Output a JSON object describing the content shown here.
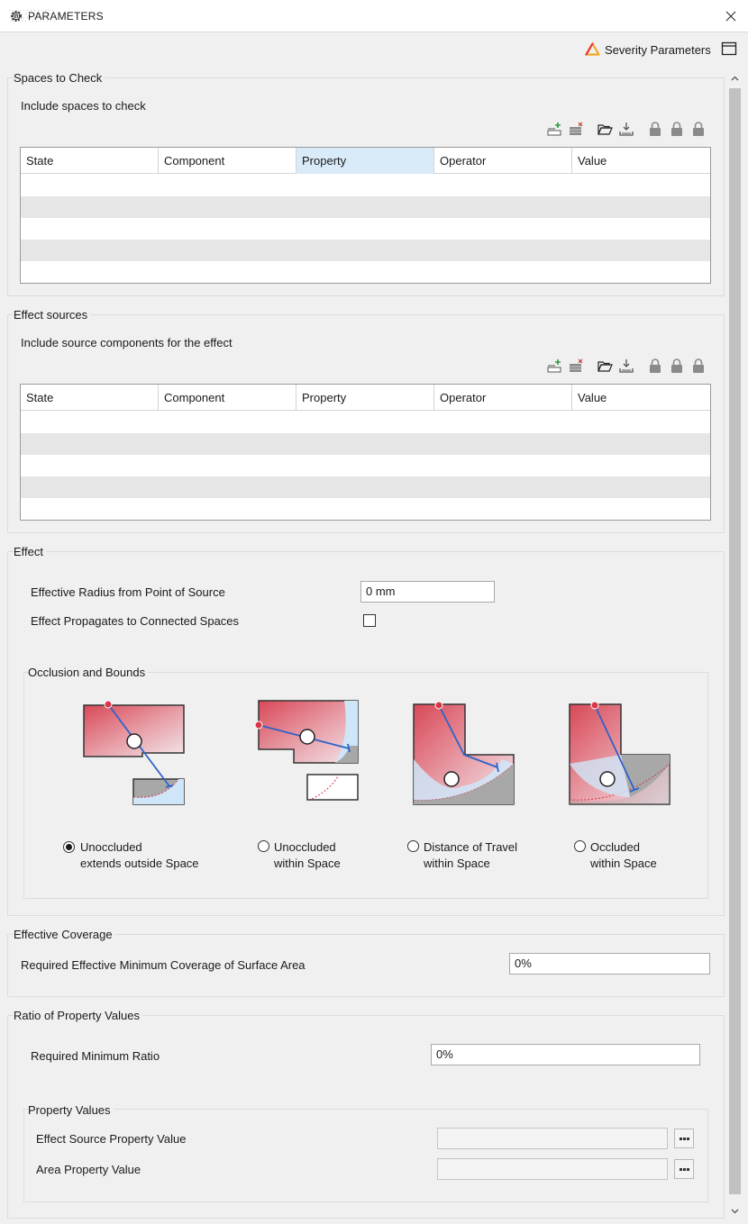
{
  "window": {
    "title": "PARAMETERS",
    "severity_label": "Severity Parameters"
  },
  "spaces_to_check": {
    "title": "Spaces to Check",
    "subtitle": "Include spaces to check",
    "columns": [
      "State",
      "Component",
      "Property",
      "Operator",
      "Value"
    ],
    "selected_column": "Property",
    "rows": [
      [],
      [],
      [],
      [],
      []
    ]
  },
  "effect_sources": {
    "title": "Effect sources",
    "subtitle": "Include source components for the effect",
    "columns": [
      "State",
      "Component",
      "Property",
      "Operator",
      "Value"
    ],
    "rows": [
      [],
      [],
      [],
      [],
      []
    ]
  },
  "effect": {
    "title": "Effect",
    "radius_label": "Effective Radius from Point of Source",
    "radius_value": "0 mm",
    "propagates_label": "Effect Propagates to Connected Spaces",
    "propagates_checked": false,
    "occlusion": {
      "title": "Occlusion and Bounds",
      "options": [
        {
          "line1": "Unoccluded",
          "line2": "extends outside Space",
          "selected": true
        },
        {
          "line1": "Unoccluded",
          "line2": "within Space",
          "selected": false
        },
        {
          "line1": "Distance of Travel",
          "line2": "within Space",
          "selected": false
        },
        {
          "line1": "Occluded",
          "line2": "within Space",
          "selected": false
        }
      ]
    }
  },
  "effective_coverage": {
    "title": "Effective Coverage",
    "label": "Required Effective Minimum Coverage of Surface Area",
    "value": "0%"
  },
  "ratio": {
    "title": "Ratio of Property Values",
    "min_ratio_label": "Required Minimum Ratio",
    "min_ratio_value": "0%",
    "property_values": {
      "title": "Property Values",
      "source_label": "Effect Source Property Value",
      "source_value": "",
      "area_label": "Area Property Value",
      "area_value": ""
    }
  },
  "icons": {
    "window": "gear-icon",
    "close": "close-icon",
    "severity": "warning-triangle-icon",
    "panel": "panel-icon",
    "grid_toolbar": [
      "add-row-icon",
      "remove-row-icon",
      "open-folder-icon",
      "download-icon",
      "lock-icon",
      "lock-icon",
      "lock-icon"
    ]
  },
  "colors": {
    "accent_red": "#d9364a",
    "accent_blue": "#2e63c9",
    "severity_orange": "#f5a623",
    "selected_header": "#d9ebf9"
  }
}
